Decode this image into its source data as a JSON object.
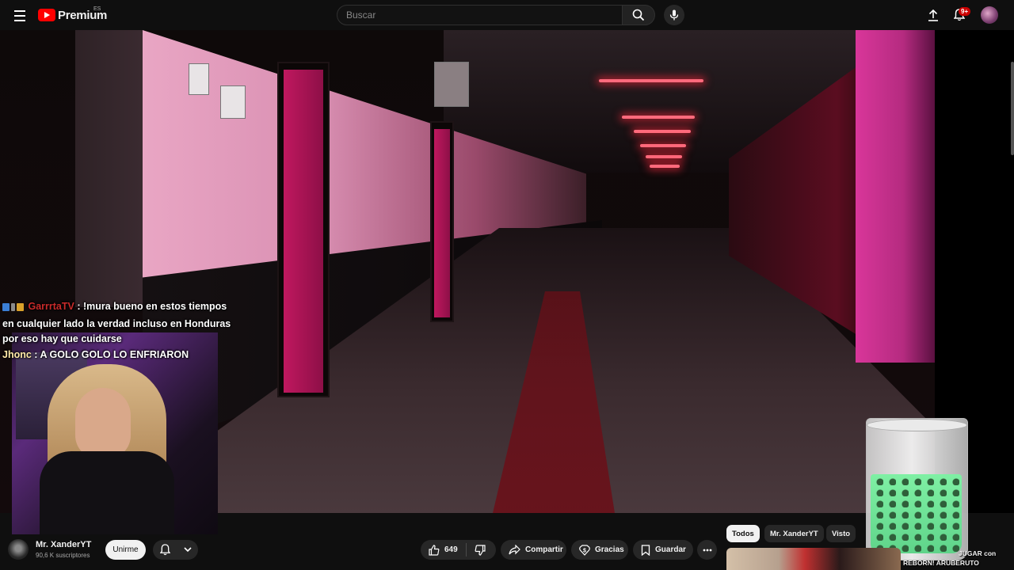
{
  "header": {
    "logo_text": "Premium",
    "region": "ES",
    "search_placeholder": "Buscar",
    "notification_badge": "9+"
  },
  "player": {
    "chat_overlay": [
      {
        "user": "GarrrtaTV",
        "message": " : !mura bueno en estos tiempos en cualquier lado la verdad incluso en Honduras por eso hay que cuidarse"
      },
      {
        "user": "Jhonc",
        "message": " : A GOLO GOLO LO ENFRIARON"
      }
    ]
  },
  "channel": {
    "name": "Mr. XanderYT",
    "subscribers": "90,6 K suscriptores",
    "join_label": "Unirme"
  },
  "actions": {
    "likes": "649",
    "share_label": "Compartir",
    "thanks_label": "Gracias",
    "save_label": "Guardar"
  },
  "related": {
    "chips": [
      "Todos",
      "Mr. XanderYT",
      "Visto"
    ],
    "first_video_title_line1": "JUGAR con",
    "first_video_title_line2": "REBORN! ARUBERUTO"
  },
  "colors": {
    "background": "#0f0f0f",
    "brand_red": "#ff0000",
    "badge_red": "#cc0000",
    "pill_bg": "#272727"
  },
  "icons": [
    "menu-icon",
    "youtube-logo-icon",
    "search-icon",
    "mic-icon",
    "create-icon",
    "bell-icon",
    "like-icon",
    "dislike-icon",
    "share-icon",
    "thanks-icon",
    "save-icon",
    "more-icon",
    "chevron-down-icon"
  ]
}
